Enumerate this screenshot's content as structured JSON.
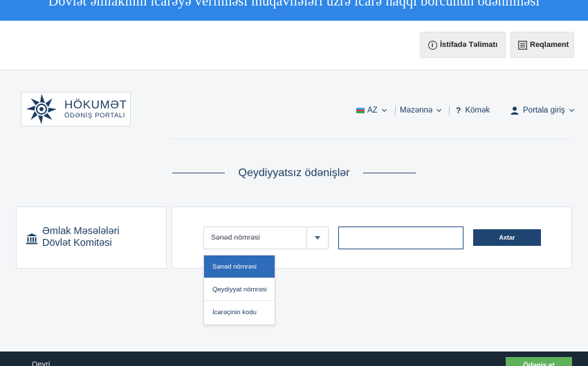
{
  "banner": {
    "title": "Dövlət əmlakının icarəyə verilməsi müqavilələri üzrə icarə haqqı borcunun ödənilməsi",
    "color": "#2f86e6"
  },
  "toolbar": {
    "instructions_label": "İstifadə Təlimatı",
    "reglament_label": "Reqlament"
  },
  "portal": {
    "logo": {
      "title": "HÖKUMƏT",
      "subtitle": "ÖDƏNİŞ PORTALI"
    },
    "nav": {
      "language": "AZ",
      "menu": "Məzənnə",
      "help": "Kömək",
      "login": "Portala giriş"
    },
    "section_title": "Qeydiyyatsız ödənişlər",
    "organization": {
      "line1": "Əmlak Məsələləri",
      "line2": "Dövlət Komitəsi",
      "icon": "bank-icon"
    },
    "search": {
      "selected_option": "Sənəd nömrəsi",
      "input_value": "",
      "button_label": "Axtar"
    },
    "dropdown": {
      "options": [
        "Sənəd nömrəsi",
        "Qeydiyyat nömrəsi",
        "İcarəçinin kodu"
      ],
      "active_index": 0
    }
  },
  "footer": {
    "text": "Qeyri",
    "button_label": "Ödəniş et"
  },
  "colors": {
    "navy": "#1f4673",
    "accent_blue": "#2e6bb8",
    "green": "#5fb15c"
  }
}
